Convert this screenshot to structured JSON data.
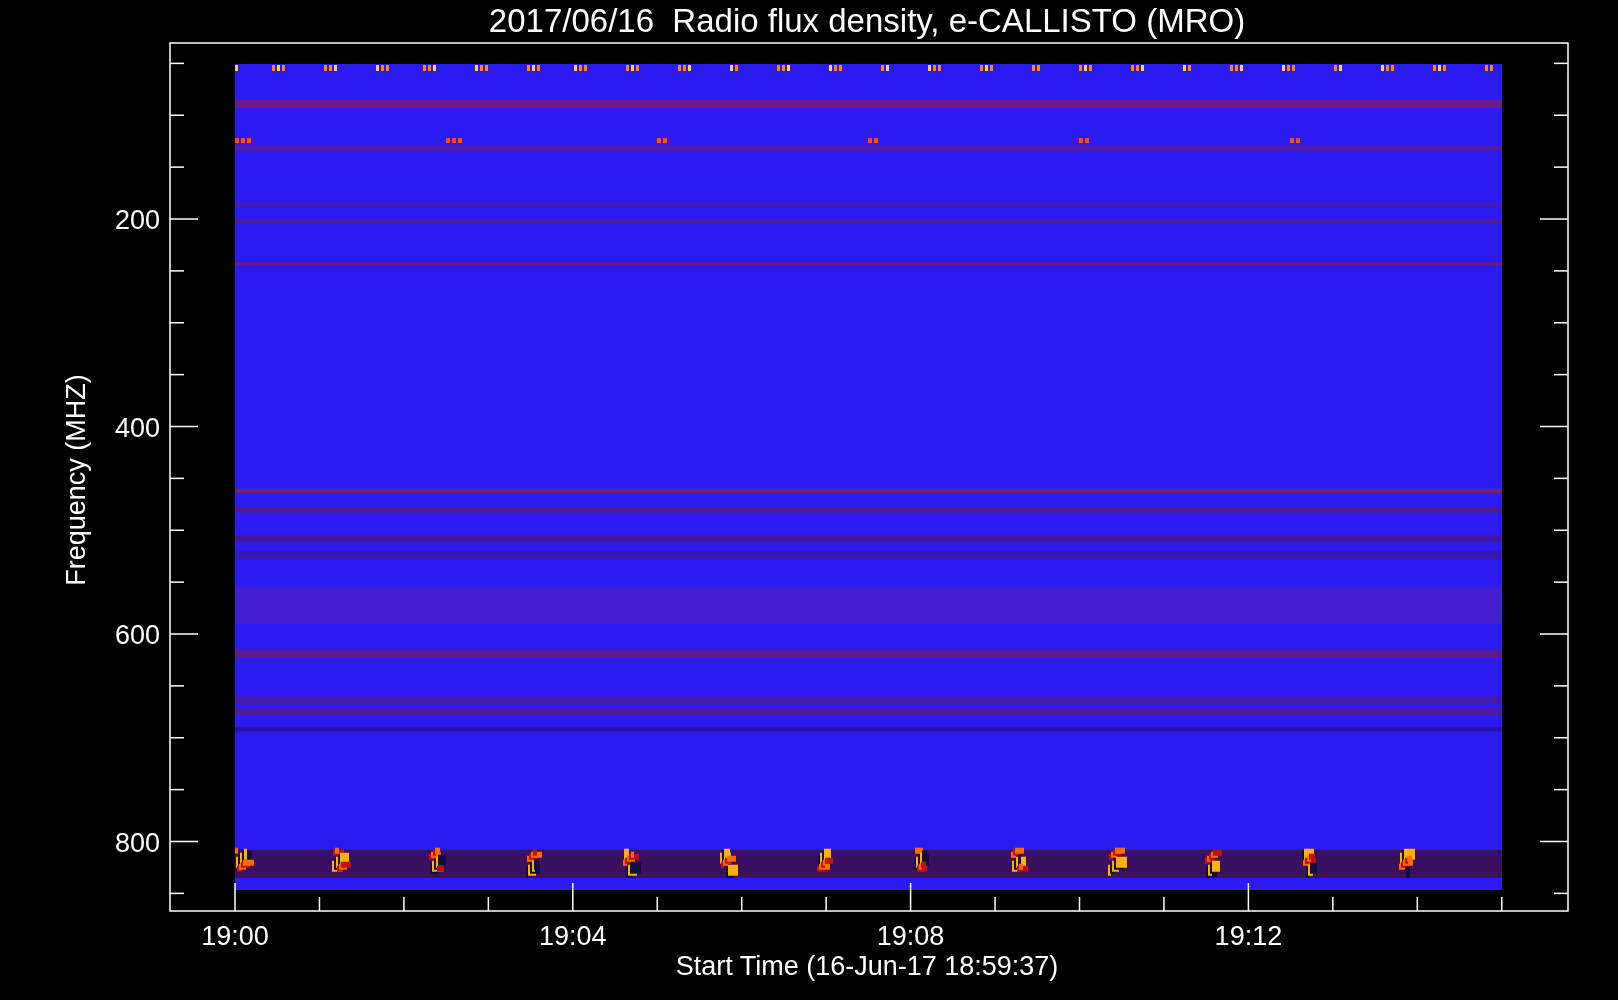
{
  "plot": {
    "title": "2017/06/16  Radio flux density, e-CALLISTO (MRO)",
    "ylabel": "Frequency (MHZ)",
    "xlabel": "Start Time (16-Jun-17 18:59:37)",
    "yticks": [
      "200",
      "400",
      "600",
      "800"
    ],
    "xticks": [
      "19:00",
      "19:04",
      "19:08",
      "19:12"
    ]
  }
}
